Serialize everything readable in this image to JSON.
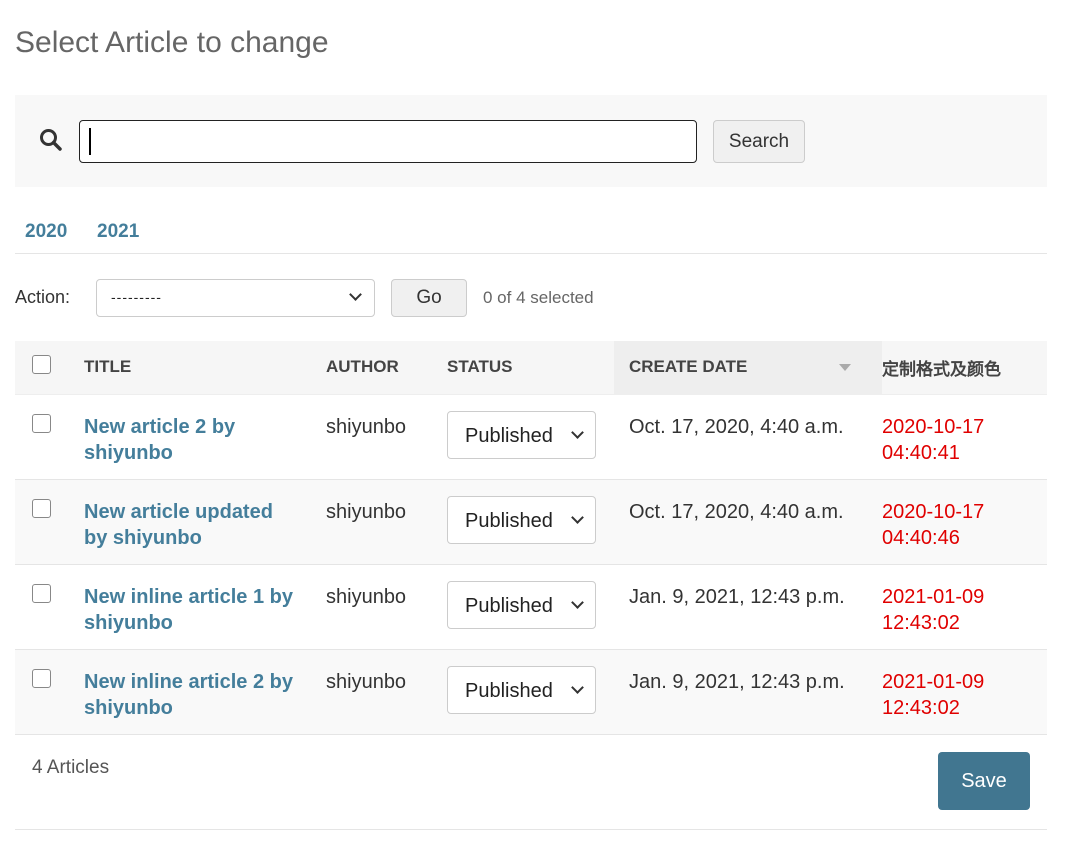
{
  "page": {
    "title": "Select Article to change"
  },
  "search": {
    "value": "",
    "button_label": "Search"
  },
  "date_hierarchy": [
    "2020",
    "2021"
  ],
  "actions": {
    "label": "Action:",
    "selected_option": "---------",
    "go_label": "Go",
    "selection_counter": "0 of 4 selected"
  },
  "table": {
    "headers": {
      "title": "TITLE",
      "author": "AUTHOR",
      "status": "STATUS",
      "create_date": "CREATE DATE",
      "custom": "定制格式及颜色"
    },
    "rows": [
      {
        "title": "New article 2 by shiyunbo",
        "author": "shiyunbo",
        "status": "Published",
        "create_date": "Oct. 17, 2020, 4:40 a.m.",
        "custom_line1": "2020-10-17",
        "custom_line2": "04:40:41"
      },
      {
        "title": "New article updated by shiyunbo",
        "author": "shiyunbo",
        "status": "Published",
        "create_date": "Oct. 17, 2020, 4:40 a.m.",
        "custom_line1": "2020-10-17",
        "custom_line2": "04:40:46"
      },
      {
        "title": "New inline article 1 by shiyunbo",
        "author": "shiyunbo",
        "status": "Published",
        "create_date": "Jan. 9, 2021, 12:43 p.m.",
        "custom_line1": "2021-01-09",
        "custom_line2": "12:43:02"
      },
      {
        "title": "New inline article 2 by shiyunbo",
        "author": "shiyunbo",
        "status": "Published",
        "create_date": "Jan. 9, 2021, 12:43 p.m.",
        "custom_line1": "2021-01-09",
        "custom_line2": "12:43:02"
      }
    ]
  },
  "footer": {
    "count": "4 Articles",
    "save_label": "Save"
  },
  "colors": {
    "link": "#447e9b",
    "custom_date": "#e00000",
    "save_button": "#417690"
  }
}
